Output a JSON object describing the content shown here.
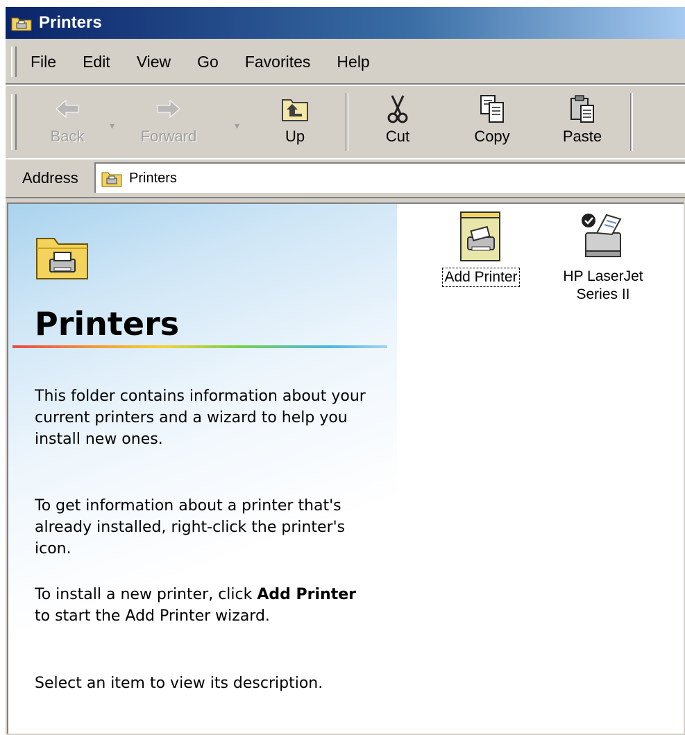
{
  "window": {
    "title": "Printers"
  },
  "menu": {
    "items": [
      {
        "label": "File"
      },
      {
        "label": "Edit"
      },
      {
        "label": "View"
      },
      {
        "label": "Go"
      },
      {
        "label": "Favorites"
      },
      {
        "label": "Help"
      }
    ]
  },
  "toolbar": {
    "back": {
      "label": "Back",
      "icon": "back-arrow-icon",
      "enabled": false
    },
    "forward": {
      "label": "Forward",
      "icon": "forward-arrow-icon",
      "enabled": false
    },
    "up": {
      "label": "Up",
      "icon": "up-folder-icon",
      "enabled": true
    },
    "cut": {
      "label": "Cut",
      "icon": "scissors-icon",
      "enabled": true
    },
    "copy": {
      "label": "Copy",
      "icon": "copy-icon",
      "enabled": true
    },
    "paste": {
      "label": "Paste",
      "icon": "paste-icon",
      "enabled": true
    }
  },
  "address": {
    "label": "Address",
    "value": "Printers",
    "icon": "printers-folder-icon"
  },
  "webview": {
    "title": "Printers",
    "paragraph1": "This folder contains information about your current printers and a wizard to help you install new ones.",
    "paragraph2": "To get information about a printer that's already installed, right-click the printer's icon.",
    "paragraph3_prefix": "To install a new printer, click ",
    "paragraph3_bold": "Add Printer",
    "paragraph3_suffix": " to start the Add Printer wizard.",
    "paragraph4": "Select an item to view its description."
  },
  "items": [
    {
      "label": "Add Printer",
      "icon": "add-printer-icon",
      "focused": true
    },
    {
      "label_line1": "HP LaserJet",
      "label_line2": "Series II",
      "icon": "laser-printer-icon",
      "default": true
    }
  ],
  "colors": {
    "titlebar_start": "#0a246a",
    "titlebar_end": "#a6caf0",
    "chrome": "#d4d0c8",
    "folder_yellow": "#f3d35b"
  }
}
